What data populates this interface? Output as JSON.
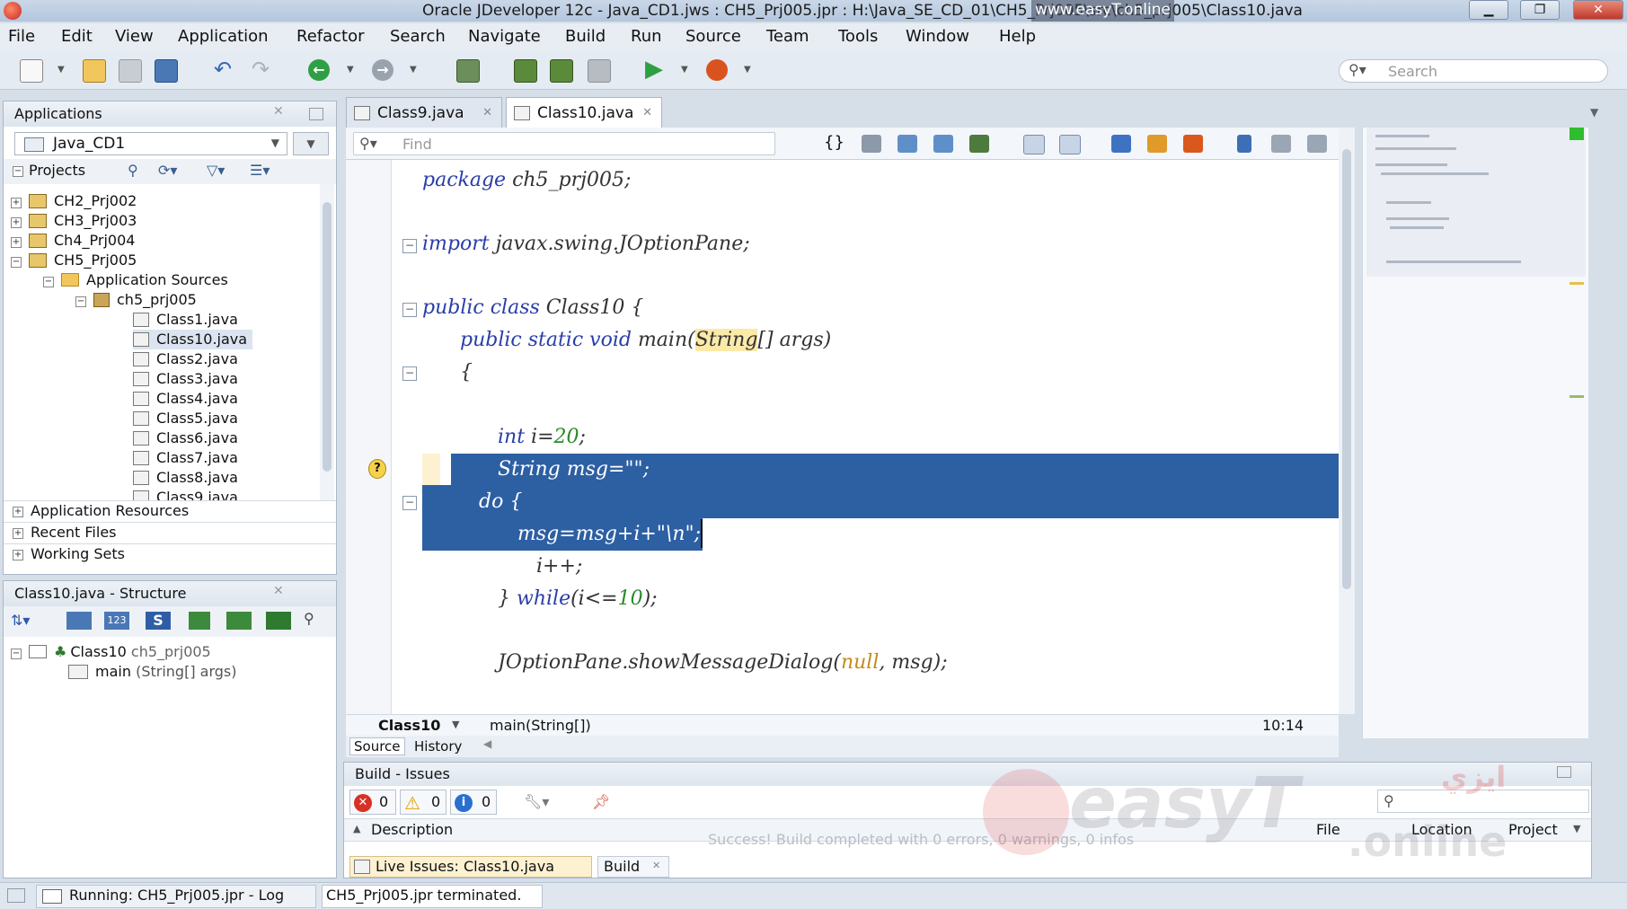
{
  "window": {
    "title": "Oracle JDeveloper 12c - Java_CD1.jws : CH5_Prj005.jpr : H:\\Java_SE_CD_01\\CH5_Prj005\\src\\ch5_prj005\\Class10.java",
    "watermark_url": "www.easyT.online"
  },
  "menu": [
    "File",
    "Edit",
    "View",
    "Application",
    "Refactor",
    "Search",
    "Navigate",
    "Build",
    "Run",
    "Source",
    "Team",
    "Tools",
    "Window",
    "Help"
  ],
  "toolbar": {
    "search_placeholder": "Search"
  },
  "applications": {
    "title": "Applications",
    "app_name": "Java_CD1",
    "projects_label": "Projects",
    "tree": [
      "CH2_Prj002",
      "CH3_Prj003",
      "Ch4_Prj004",
      "CH5_Prj005",
      "Application Sources",
      "ch5_prj005",
      "Class1.java",
      "Class10.java",
      "Class2.java",
      "Class3.java",
      "Class4.java",
      "Class5.java",
      "Class6.java",
      "Class7.java",
      "Class8.java",
      "Class9.java"
    ],
    "sections": [
      "Application Resources",
      "Recent Files",
      "Working Sets"
    ]
  },
  "structure": {
    "title": "Class10.java - Structure",
    "class_name": "Class10",
    "class_pkg": "ch5_prj005",
    "method_name": "main",
    "method_sig": "(String[] args)"
  },
  "editor": {
    "tabs": [
      "Class9.java",
      "Class10.java"
    ],
    "find_placeholder": "Find",
    "code": {
      "pkg_kw": "package",
      "pkg_name": " ch5_prj005;",
      "imp_kw": "import",
      "imp_name": " javax.swing.JOptionPane;",
      "cls_kw": "public class",
      "cls_name": " Class10 {",
      "main_kw": "public static void",
      "main_name": " main(",
      "main_type": "String",
      "main_rest": "[] args)",
      "brace": "{",
      "int_kw": "int",
      "int_rest": " i=",
      "int_val": "20",
      "int_end": ";",
      "str_line": "String msg=\"\";",
      "do_line": "do {",
      "msg_line": "msg=msg+i+\"\\n\";",
      "inc_line": "i++;",
      "while_pre": "} ",
      "while_kw": "while",
      "while_mid": "(i<=",
      "while_val": "10",
      "while_end": ");",
      "jop_pre": "JOptionPane.showMessageDialog(",
      "jop_null": "null",
      "jop_end": ", msg);"
    },
    "breadcrumb": [
      "Class10",
      "main(String[])"
    ],
    "position": "10:14",
    "bottom_tabs": [
      "Source",
      "History"
    ]
  },
  "build": {
    "title": "Build - Issues",
    "errors": "0",
    "warnings": "0",
    "infos": "0",
    "col_description": "Description",
    "col_file": "File",
    "col_location": "Location",
    "col_project": "Project",
    "message": "Success! Build completed with 0 errors, 0 warnings, 0 infos",
    "tab_live": "Live Issues: Class10.java",
    "tab_build": "Build"
  },
  "statusbar": {
    "running": "Running: CH5_Prj005.jpr - Log",
    "terminated": "CH5_Prj005.jpr terminated."
  },
  "watermark": {
    "arabic": "ايزي",
    "latin": "easyT",
    "suffix": ".online"
  }
}
